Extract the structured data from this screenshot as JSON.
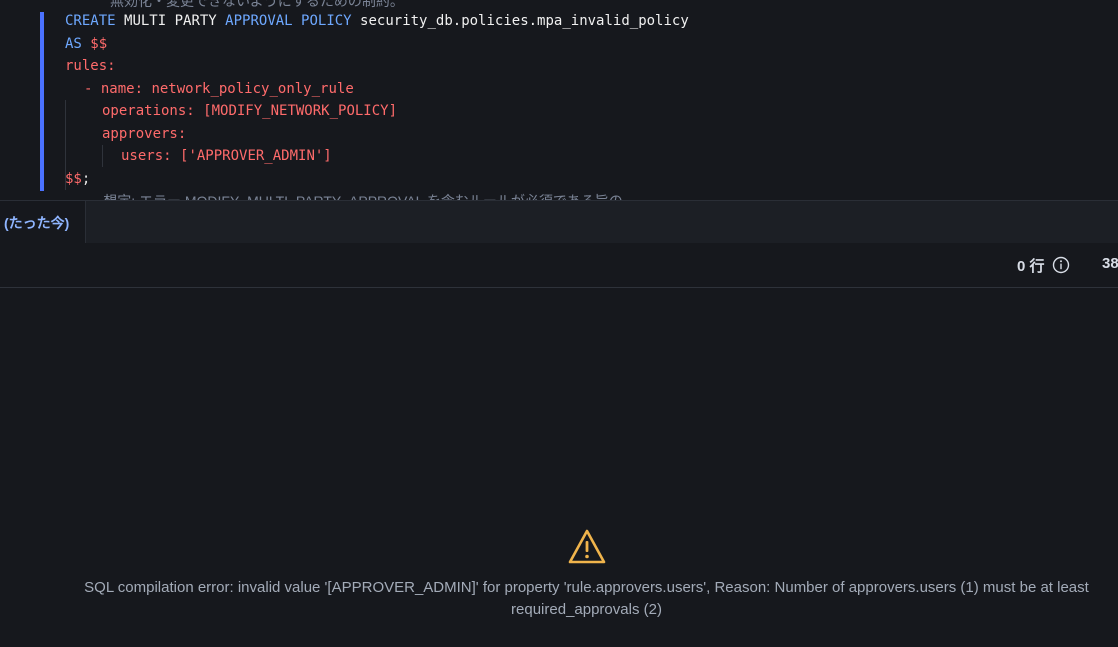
{
  "editor": {
    "comment_top": "無効化・変更できないようにするための制約。",
    "line1": {
      "kw_create": "CREATE",
      "kw_multi_party": "MULTI PARTY",
      "kw_approval_policy": "APPROVAL POLICY",
      "policy_name": "security_db.policies.mpa_invalid_policy"
    },
    "line2": {
      "kw_as": "AS",
      "delim": "$$"
    },
    "line3": {
      "key": "rules:"
    },
    "line4": {
      "dash_name": "- name:",
      "value": "network_policy_only_rule"
    },
    "line5": {
      "key": "operations:",
      "value": "[MODIFY_NETWORK_POLICY]"
    },
    "line6": {
      "key": "approvers:"
    },
    "line7": {
      "key": "users:",
      "value": "['APPROVER_ADMIN']"
    },
    "line8": {
      "delim": "$$",
      "semicolon": ";"
    },
    "comment_bottom": "-- 想定: エラー MODIFY_MULTI_PARTY_APPROVAL を含むルールが必須である旨の"
  },
  "history": {
    "tab_label": "(たった今)"
  },
  "results": {
    "row_count": "0 行",
    "elapsed": "38"
  },
  "error": {
    "message": "SQL compilation error: invalid value '[APPROVER_ADMIN]' for property 'rule.approvers.users', Reason: Number of approvers.users (1) must be at least required_approvals (2)"
  },
  "colors": {
    "background": "#16181d",
    "keyword": "#6ea8ff",
    "yaml": "#ff6b6b",
    "gutter_marker": "#4b72ff",
    "warning": "#f0b44c"
  }
}
